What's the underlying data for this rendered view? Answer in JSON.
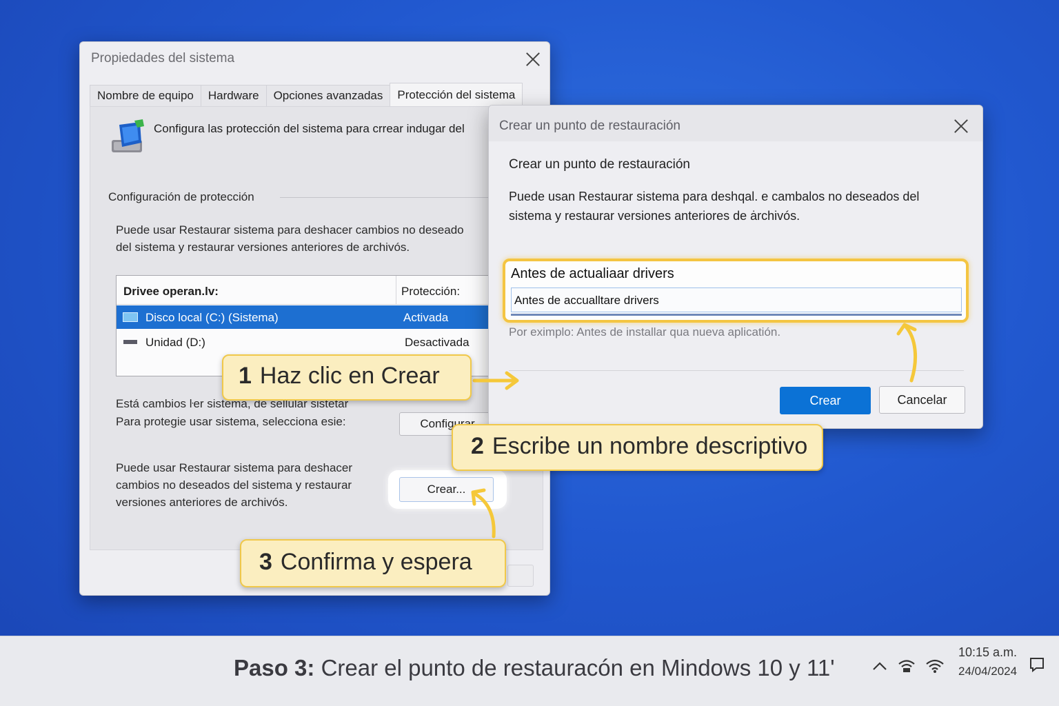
{
  "main_window": {
    "title": "Propiedades del sistema",
    "tabs": [
      "Nombre de equipo",
      "Hardware",
      "Opciones avanzadas",
      "Protección del sistema"
    ],
    "intro_text": "Configura las protección del sistema para crrear indugar del",
    "group_title": "Configuración de protección",
    "paragraph_1": "Puede usar Restaurar sistema para deshacer cambios no deseado",
    "paragraph_1b": "del sistema y restaurar versiones anteriores de archivós.",
    "drives_table": {
      "col_drives": "Drivee operan.lv:",
      "col_protection": "Protección:",
      "rows": [
        {
          "name": "Disco local (C:) (Sistema)",
          "protection": "Activada"
        },
        {
          "name": "Unidad (D:)",
          "protection": "Desactivada"
        }
      ]
    },
    "config_text_1": "Está cambios ŀer sistema, de sellular sistetar",
    "config_text_2": "Para protegie usar sistema, selecciona esie:",
    "configure_button": "Configurar",
    "create_text_1": "Puede usar Restaurar sistema para deshacer",
    "create_text_2": "cambios no deseados del sistema y restaurar",
    "create_text_3": "versiones anteriores de archivós.",
    "create_button": "Crear..."
  },
  "dialog": {
    "title": "Crear un punto de restauración",
    "heading": "Crear un punto de restauración",
    "paragraph": "Puede usan Restaurar sistema para deshqal. e cambalos no deseados del sistema y restaurar versiones anteriores de ȧrchivós.",
    "input_line_1": "Antes de actualiaar drivers",
    "input_value": "Antes de accualltare drivers",
    "hint": "Por eximplo: Antes de installar qua nueva aplicatión.",
    "create_button": "Crear",
    "cancel_button": "Cancelar"
  },
  "callouts": [
    {
      "number": "1",
      "text": "Haz clic en Crear"
    },
    {
      "number": "2",
      "text": "Escribe un nombre descriptivo"
    },
    {
      "number": "3",
      "text": "Confirma y espera"
    }
  ],
  "taskbar": {
    "caption_bold": "Paso 3:",
    "caption_rest": "Crear el punto de restauracón en Mindows 10 y 11'",
    "time": "10:15 a.m.",
    "date": "24/04/2024",
    "icons": [
      "chevron-up-icon",
      "network-icon",
      "wifi-icon",
      "notification-icon"
    ]
  },
  "colors": {
    "desktop": "#2158cf",
    "accent": "#0b72d6",
    "selection": "#1d6fd1",
    "callout_bg": "#fbeec0",
    "callout_border": "#f0c84a"
  }
}
